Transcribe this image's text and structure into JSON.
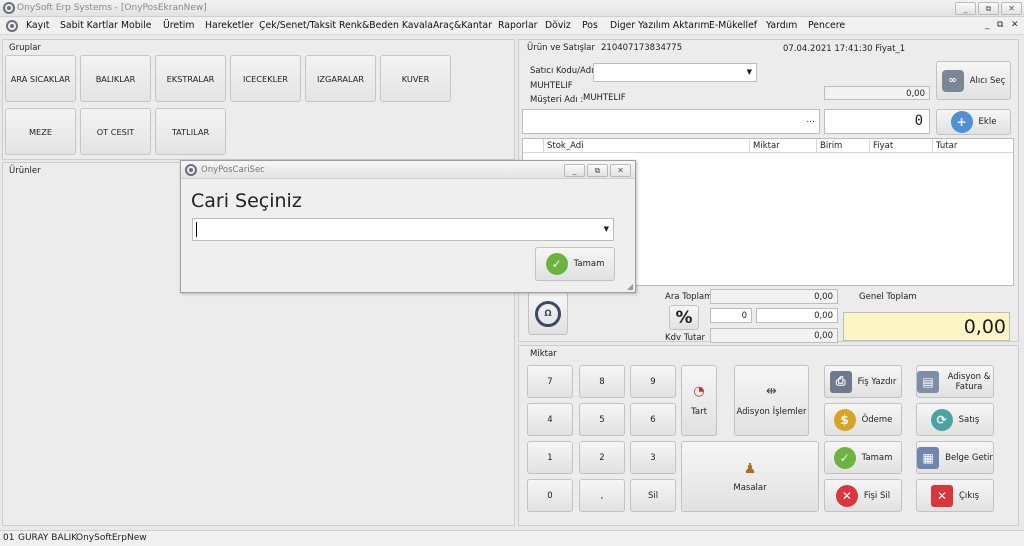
{
  "window": {
    "title": "OnySoft Erp Systems - [OnyPosEkranNew]",
    "min": "_",
    "max": "⧉",
    "close": "✕"
  },
  "menu": [
    "Kayıt",
    "Sabit Kartlar",
    "Mobile",
    "Üretim",
    "Hareketler",
    "Çek/Senet/Taksit",
    "Renk&Beden Kavala",
    "Araç&Kantar",
    "Raporlar",
    "Döviz",
    "Pos",
    "Diger Yazılım Aktarım",
    "E-Mükellef",
    "Yardım",
    "Pencere"
  ],
  "mdi": {
    "min": "_",
    "restore": "⧉",
    "close": "✕"
  },
  "groups": {
    "title": "Gruplar",
    "items": [
      "ARA SICAKLAR",
      "BALIKLAR",
      "EKSTRALAR",
      "ICECEKLER",
      "IZGARALAR",
      "KUVER",
      "MEZE",
      "OT CESIT",
      "TATLILAR"
    ]
  },
  "products": {
    "title": "Ürünler"
  },
  "sales": {
    "title": "Ürün ve Satışlar",
    "doc_no": "210407173834775",
    "datetime": "07.04.2021 17:41:30 Fiyat_1",
    "seller_label": "Satıcı Kodu/Adı :",
    "seller_value": "",
    "customer_code": "MUHTELIF",
    "customer_label": "Müşteri Adı :",
    "customer_name": "MUHTELIF",
    "balance": "0,00",
    "buyer_select": "Alıcı Seç",
    "search_more": "...",
    "qty_value": "0",
    "add": "Ekle",
    "columns": [
      "Stok_Adi",
      "Miktar",
      "Birim",
      "Fiyat",
      "Tutar"
    ]
  },
  "totals": {
    "subtotal_label": "Ara Toplam",
    "subtotal": "0,00",
    "discount_rate": "0",
    "discount_amount": "0,00",
    "vat_label": "Kdv Tutar",
    "vat": "0,00",
    "grand_label": "Genel Toplam",
    "grand": "0,00",
    "percent": "%"
  },
  "keypad": {
    "title": "Miktar",
    "keys": [
      "7",
      "8",
      "9",
      "4",
      "5",
      "6",
      "1",
      "2",
      "3",
      "0",
      ",",
      "Sil"
    ],
    "tart": "Tart",
    "adisyon": "Adisyon İşlemler",
    "masalar": "Masalar"
  },
  "actions": {
    "fis_yazdir": "Fiş Yazdır",
    "odeme": "Ödeme",
    "tamam": "Tamam",
    "fisi_sil": "Fişi Sil",
    "adisyon_fatura": "Adisyon & Fatura",
    "satis": "Satış",
    "belge_getir": "Belge Getir",
    "cikis": "Çıkış"
  },
  "dialog": {
    "title": "OnyPosCariSec",
    "heading": "Cari Seçiniz",
    "input": "",
    "ok": "Tamam"
  },
  "status": {
    "code": "01",
    "user": "GURAY BALIK",
    "app": "OnySoftErpNew"
  }
}
